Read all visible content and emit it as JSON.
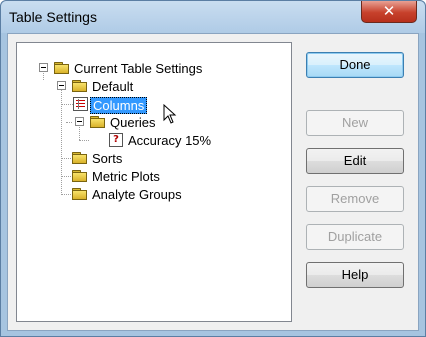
{
  "window": {
    "title": "Table Settings",
    "close_glyph": "✕"
  },
  "tree": {
    "root": "Current Table Settings",
    "default": "Default",
    "columns": "Columns",
    "queries": "Queries",
    "accuracy": "Accuracy 15%",
    "sorts": "Sorts",
    "metric_plots": "Metric Plots",
    "analyte_groups": "Analyte Groups"
  },
  "buttons": {
    "done": "Done",
    "new": "New",
    "edit": "Edit",
    "remove": "Remove",
    "duplicate": "Duplicate",
    "help": "Help"
  },
  "icons": {
    "folder": "folder-icon",
    "columns": "columns-table-icon",
    "query": "query-icon",
    "collapse": "minus-expander-icon"
  },
  "colors": {
    "selection": "#3399ff",
    "default_button_border": "#3c7fb1"
  }
}
